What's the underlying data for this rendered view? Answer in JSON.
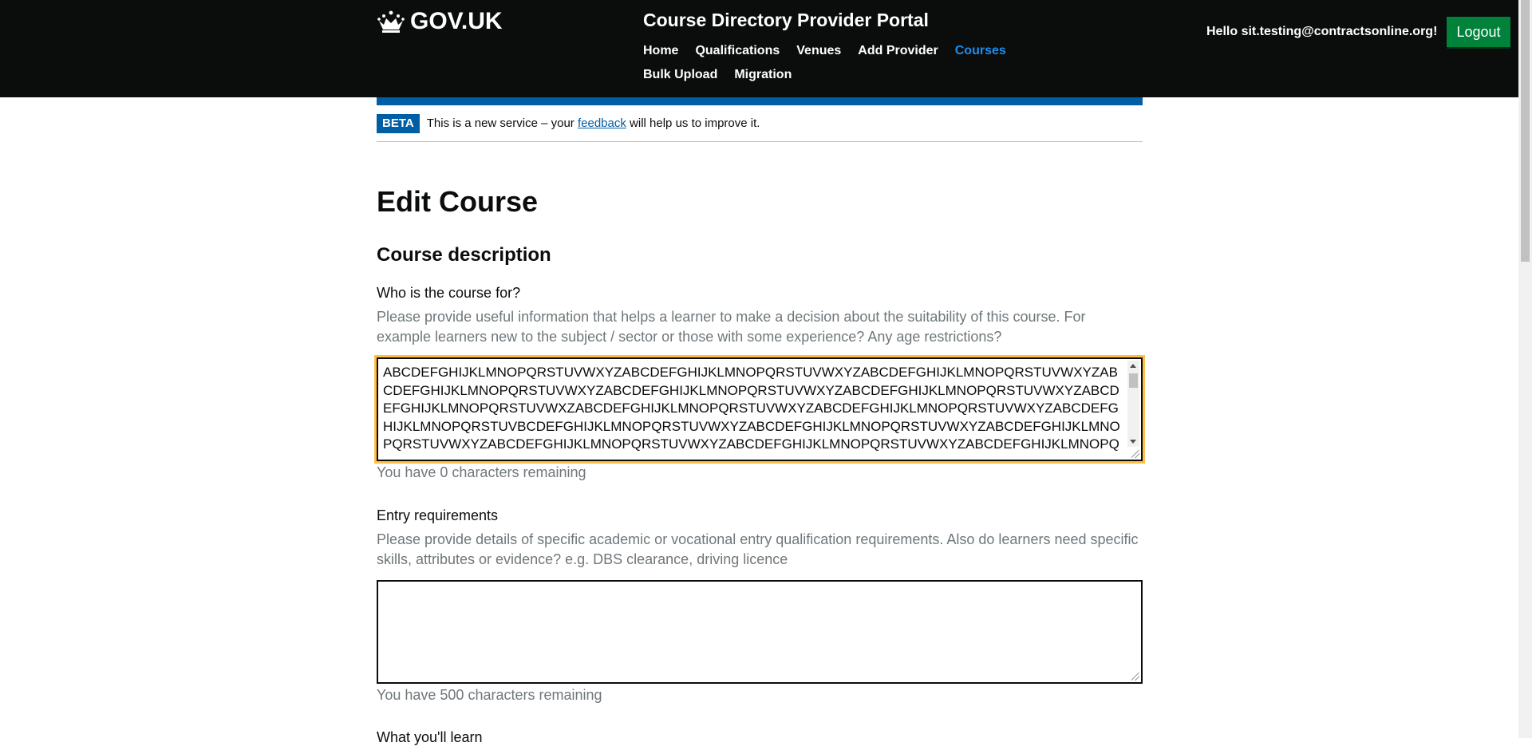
{
  "header": {
    "logo_text": "GOV.UK",
    "service_name": "Course Directory Provider Portal",
    "nav": [
      {
        "label": "Home",
        "active": false
      },
      {
        "label": "Qualifications",
        "active": false
      },
      {
        "label": "Venues",
        "active": false
      },
      {
        "label": "Add Provider",
        "active": false
      },
      {
        "label": "Courses",
        "active": true
      },
      {
        "label": "Bulk Upload",
        "active": false
      },
      {
        "label": "Migration",
        "active": false
      }
    ],
    "greeting": "Hello sit.testing@contractsonline.org!",
    "logout_label": "Logout"
  },
  "beta": {
    "tag": "BETA",
    "text_before": "This is a new service – your ",
    "link_text": "feedback",
    "text_after": " will help us to improve it."
  },
  "page_title": "Edit Course",
  "section_title": "Course description",
  "fields": {
    "who_for": {
      "label": "Who is the course for?",
      "hint": "Please provide useful information that helps a learner to make a decision about the suitability of this course. For example learners new to the subject / sector or those with some experience? Any age restrictions?",
      "value": "ABCDEFGHIJKLMNOPQRSTUVWXYZABCDEFGHIJKLMNOPQRSTUVWXYZABCDEFGHIJKLMNOPQRSTUVWXYZABCDEFGHIJKLMNOPQRSTUVWXYZABCDEFGHIJKLMNOPQRSTUVWXYZABCDEFGHIJKLMNOPQRSTUVWXYZABCDEFGHIJKLMNOPQRSTUVWXZABCDEFGHIJKLMNOPQRSTUVWXYZABCDEFGHIJKLMNOPQRSTUVWXYZABCDEFGHIJKLMNOPQRSTUVBCDEFGHIJKLMNOPQRSTUVWXYZABCDEFGHIJKLMNOPQRSTUVWXYZABCDEFGHIJKLMNOPQRSTUVWXYZABCDEFGHIJKLMNOPQRSTUVWXYZABCDEFGHIJKLMNOPQRSTUVWXYZABCDEFGHIJKLMNOPQRSTUVWXYZABCDEFGHIJKLMNOPQRSTUVWXYZABCDEFGHIJKLMNOPQRSTUVWXYZABCDEFGHIJKLMNOPQRSTUVWXYZABCDEF",
      "counter": "You have 0 characters remaining"
    },
    "entry_requirements": {
      "label": "Entry requirements",
      "hint": "Please provide details of specific academic or vocational entry qualification requirements. Also do learners need specific skills, attributes or evidence? e.g. DBS clearance, driving licence",
      "value": "",
      "counter": "You have 500 characters remaining"
    },
    "what_learn": {
      "label": "What you'll learn"
    }
  },
  "colors": {
    "header_bg": "#0b0c0c",
    "nav_active": "#1d8feb",
    "logout_bg": "#00823b",
    "beta_blue": "#005ea5",
    "focus_yellow": "#ffbf47",
    "hint_grey": "#6f777b"
  }
}
